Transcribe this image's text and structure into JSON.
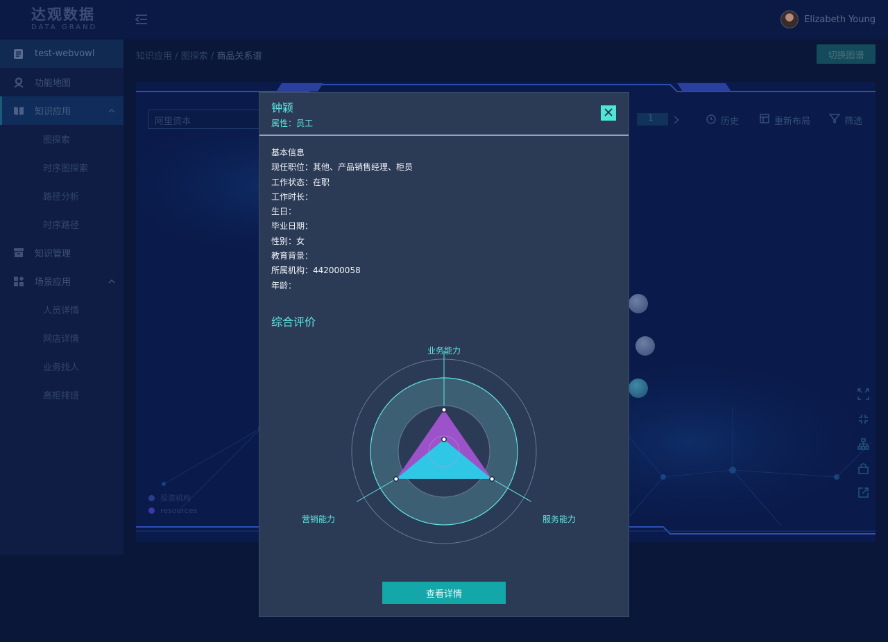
{
  "brand": {
    "name_cn": "达观数据",
    "name_en": "DATA GRAND"
  },
  "user": {
    "name": "Elizabeth Young"
  },
  "sidebar": {
    "project": "test-webvowl",
    "items": [
      {
        "label": "功能地图"
      },
      {
        "label": "知识应用",
        "subitems": [
          "图探索",
          "时序图探索",
          "路径分析",
          "时序路径"
        ]
      },
      {
        "label": "知识管理"
      },
      {
        "label": "场景应用",
        "subitems": [
          "人员详情",
          "网店详情",
          "业务找人",
          "高柜排班"
        ]
      }
    ]
  },
  "breadcrumb": {
    "level1": "知识应用",
    "level2": "图探索",
    "current": "商品关系谱",
    "separator": "/"
  },
  "header": {
    "switch_graph": "切换图谱"
  },
  "graph": {
    "search_value": "阿里资本",
    "page": "1",
    "tools": {
      "history": "历史",
      "relayout": "重新布局",
      "filter": "筛选"
    },
    "legend": [
      {
        "label": "投资机构",
        "color": "#2a3c8a"
      },
      {
        "label": "resources",
        "color": "#3a3aa8"
      }
    ]
  },
  "modal": {
    "title": "钟颖",
    "attribute": "属性：员工",
    "info": [
      "基本信息",
      "现任职位：其他、产品销售经理、柜员",
      "工作状态：在职",
      "工作时长：",
      "生日：",
      "毕业日期：",
      "性别：女",
      "教育背景：",
      "所属机构：442000058",
      "年龄："
    ],
    "section_title": "综合评价",
    "detail_button": "查看详情"
  },
  "chart_data": {
    "type": "radar",
    "axes": [
      "业务能力",
      "服务能力",
      "营销能力"
    ],
    "series": [
      {
        "values": [
          0.45,
          0.6,
          0.6
        ],
        "color": "#a855d6"
      },
      {
        "values": [
          0.13,
          0.6,
          0.6
        ],
        "color": "#22d4e8"
      }
    ],
    "colors": {
      "ring": "#3c5f74",
      "ring_stroke": "#5fe7e0",
      "outer_circle": "#6a7a99"
    }
  }
}
